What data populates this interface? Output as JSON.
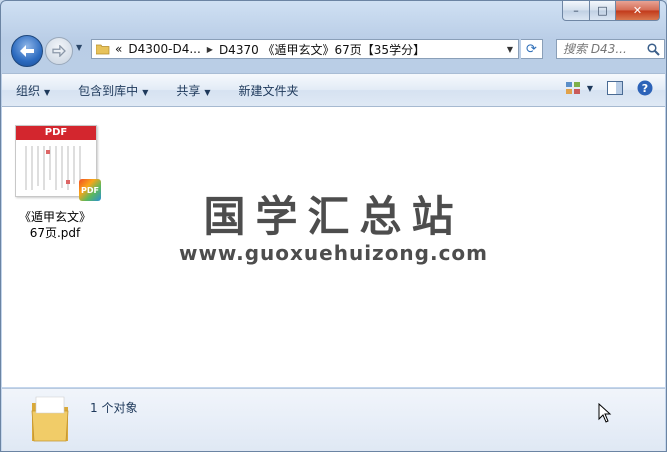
{
  "window": {
    "controls": {
      "minimize": "–",
      "maximize": "□",
      "close": "✕"
    }
  },
  "nav": {
    "back_icon": "back-arrow-icon",
    "forward_icon": "forward-arrow-icon"
  },
  "address": {
    "overflow": "«",
    "segments": [
      "D4300-D4...",
      "D4370 《遁甲玄文》67页【35学分】"
    ]
  },
  "search": {
    "placeholder": "搜索 D43..."
  },
  "toolbar": {
    "organize": "组织",
    "include_in_library": "包含到库中",
    "share": "共享",
    "new_folder": "新建文件夹"
  },
  "files": [
    {
      "name_line1": "《遁甲玄文》",
      "name_line2": "67页.pdf",
      "type_label": "PDF",
      "badge": "PDF"
    }
  ],
  "watermark": {
    "title": "国学汇总站",
    "url": "www.guoxuehuizong.com"
  },
  "status": {
    "count_text": "1 个对象"
  },
  "colors": {
    "pdf_red": "#d3262e",
    "window_frame": "#b9cde6",
    "accent_blue": "#2c6bc0"
  }
}
